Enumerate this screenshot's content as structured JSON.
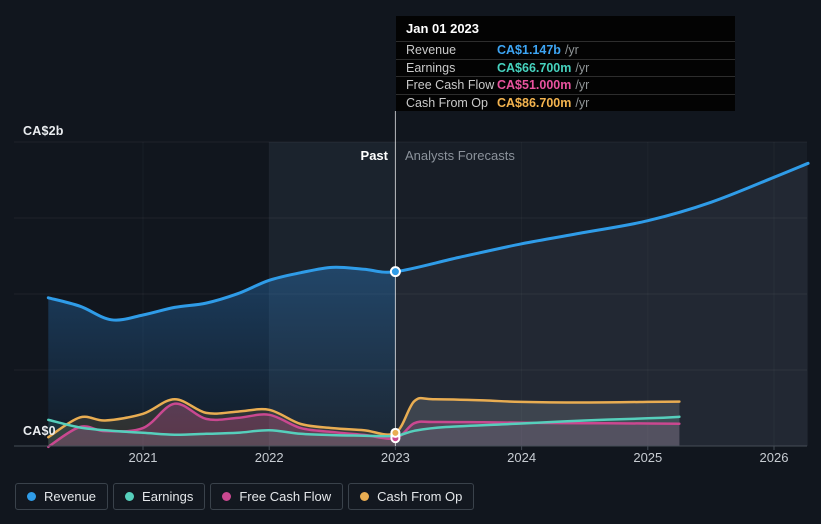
{
  "labels": {
    "y_top": "CA$2b",
    "y_zero": "CA$0",
    "past": "Past",
    "forecast": "Analysts Forecasts"
  },
  "tooltip": {
    "date": "Jan 01 2023",
    "rows": [
      {
        "label": "Revenue",
        "value": "CA$1.147b",
        "suffix": "/yr",
        "color": "#3da5f4"
      },
      {
        "label": "Earnings",
        "value": "CA$66.700m",
        "suffix": "/yr",
        "color": "#46d2be"
      },
      {
        "label": "Free Cash Flow",
        "value": "CA$51.000m",
        "suffix": "/yr",
        "color": "#e8539e"
      },
      {
        "label": "Cash From Op",
        "value": "CA$86.700m",
        "suffix": "/yr",
        "color": "#f4b44f"
      }
    ]
  },
  "legend": [
    {
      "label": "Revenue",
      "color": "#2f9ce8"
    },
    {
      "label": "Earnings",
      "color": "#56cfbc"
    },
    {
      "label": "Free Cash Flow",
      "color": "#ca4890"
    },
    {
      "label": "Cash From Op",
      "color": "#e9ad52"
    }
  ],
  "chart_data": {
    "type": "line",
    "title": "Earnings and Revenue Growth",
    "y_unit": "CA$ millions",
    "ylim": [
      0,
      2000
    ],
    "xlim": [
      2020.0,
      2026.35
    ],
    "x_ticks": [
      2021,
      2022,
      2023,
      2024,
      2025,
      2026
    ],
    "y_gridlines_m": [
      0,
      500,
      1000,
      1500,
      2000
    ],
    "past_until": 2023.0,
    "highlight_band": [
      2022.0,
      2023.0
    ],
    "hover_x": 2023.0,
    "legend_position": "bottom-left",
    "series": [
      {
        "name": "Revenue",
        "color": "#2f9ce8",
        "end": 2026.27,
        "points": [
          [
            2020.25,
            975
          ],
          [
            2020.5,
            920
          ],
          [
            2020.75,
            830
          ],
          [
            2021,
            862
          ],
          [
            2021.25,
            912
          ],
          [
            2021.5,
            940
          ],
          [
            2021.75,
            1002
          ],
          [
            2022,
            1090
          ],
          [
            2022.25,
            1140
          ],
          [
            2022.5,
            1175
          ],
          [
            2022.75,
            1163
          ],
          [
            2023,
            1147
          ],
          [
            2023.5,
            1240
          ],
          [
            2024,
            1330
          ],
          [
            2024.5,
            1405
          ],
          [
            2025,
            1482
          ],
          [
            2025.5,
            1603
          ],
          [
            2026,
            1768
          ],
          [
            2026.27,
            1860
          ]
        ]
      },
      {
        "name": "Earnings",
        "color": "#56cfbc",
        "end": 2025.25,
        "points": [
          [
            2020.25,
            172
          ],
          [
            2020.5,
            122
          ],
          [
            2020.75,
            100
          ],
          [
            2021,
            87
          ],
          [
            2021.25,
            74
          ],
          [
            2021.5,
            80
          ],
          [
            2021.75,
            87
          ],
          [
            2022,
            104
          ],
          [
            2022.25,
            80
          ],
          [
            2022.5,
            72
          ],
          [
            2022.75,
            68
          ],
          [
            2023,
            66.7
          ],
          [
            2023.15,
            100
          ],
          [
            2023.4,
            125
          ],
          [
            2024,
            148
          ],
          [
            2024.5,
            168
          ],
          [
            2025,
            182
          ],
          [
            2025.25,
            192
          ]
        ]
      },
      {
        "name": "Free Cash Flow",
        "color": "#ca4890",
        "end": 2025.25,
        "points": [
          [
            2020.25,
            -5
          ],
          [
            2020.5,
            125
          ],
          [
            2020.7,
            98
          ],
          [
            2021,
            118
          ],
          [
            2021.25,
            278
          ],
          [
            2021.5,
            178
          ],
          [
            2021.75,
            185
          ],
          [
            2022,
            205
          ],
          [
            2022.25,
            118
          ],
          [
            2022.5,
            92
          ],
          [
            2022.75,
            73
          ],
          [
            2023,
            51
          ],
          [
            2023.15,
            150
          ],
          [
            2023.3,
            158
          ],
          [
            2023.7,
            156
          ],
          [
            2024,
            153
          ],
          [
            2024.5,
            150
          ],
          [
            2025,
            148
          ],
          [
            2025.25,
            147
          ]
        ]
      },
      {
        "name": "Cash From Op",
        "color": "#e9ad52",
        "end": 2025.25,
        "points": [
          [
            2020.25,
            58
          ],
          [
            2020.5,
            188
          ],
          [
            2020.7,
            168
          ],
          [
            2021,
            212
          ],
          [
            2021.25,
            308
          ],
          [
            2021.5,
            218
          ],
          [
            2021.75,
            226
          ],
          [
            2022,
            238
          ],
          [
            2022.25,
            145
          ],
          [
            2022.5,
            118
          ],
          [
            2022.75,
            104
          ],
          [
            2023,
            86.7
          ],
          [
            2023.15,
            295
          ],
          [
            2023.3,
            308
          ],
          [
            2023.7,
            300
          ],
          [
            2024,
            290
          ],
          [
            2024.5,
            286
          ],
          [
            2025,
            290
          ],
          [
            2025.25,
            292
          ]
        ]
      }
    ]
  }
}
